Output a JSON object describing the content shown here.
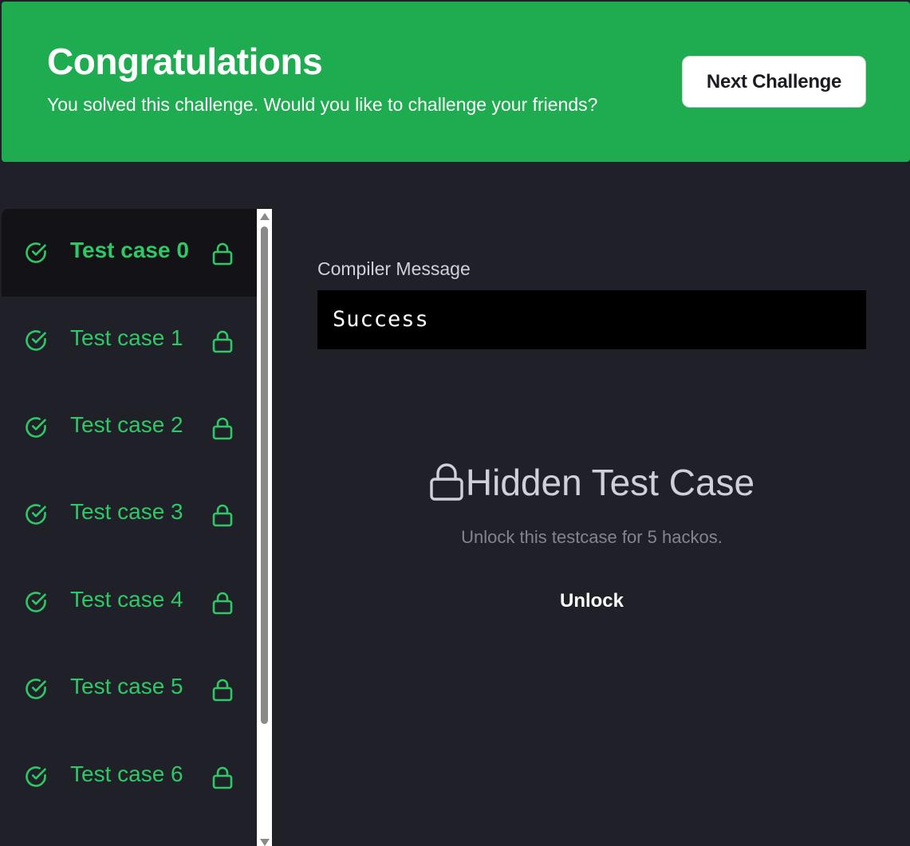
{
  "banner": {
    "title": "Congratulations",
    "subtitle": "You solved this challenge. Would you like to challenge your friends?",
    "next_button_label": "Next Challenge",
    "background_color": "#1fab4f"
  },
  "sidebar": {
    "active_index": 0,
    "accent_color": "#2ec866",
    "items": [
      {
        "label": "Test case 0",
        "status_icon": "check-circle-icon",
        "lock_icon": "lock-icon"
      },
      {
        "label": "Test case 1",
        "status_icon": "check-circle-icon",
        "lock_icon": "lock-icon"
      },
      {
        "label": "Test case 2",
        "status_icon": "check-circle-icon",
        "lock_icon": "lock-icon"
      },
      {
        "label": "Test case 3",
        "status_icon": "check-circle-icon",
        "lock_icon": "lock-icon"
      },
      {
        "label": "Test case 4",
        "status_icon": "check-circle-icon",
        "lock_icon": "lock-icon"
      },
      {
        "label": "Test case 5",
        "status_icon": "check-circle-icon",
        "lock_icon": "lock-icon"
      },
      {
        "label": "Test case 6",
        "status_icon": "check-circle-icon",
        "lock_icon": "lock-icon"
      }
    ]
  },
  "main": {
    "compiler_label": "Compiler Message",
    "compiler_output": "Success",
    "hidden_title": "Hidden Test Case",
    "unlock_description": "Unlock this testcase for 5 hackos.",
    "unlock_button_label": "Unlock"
  }
}
